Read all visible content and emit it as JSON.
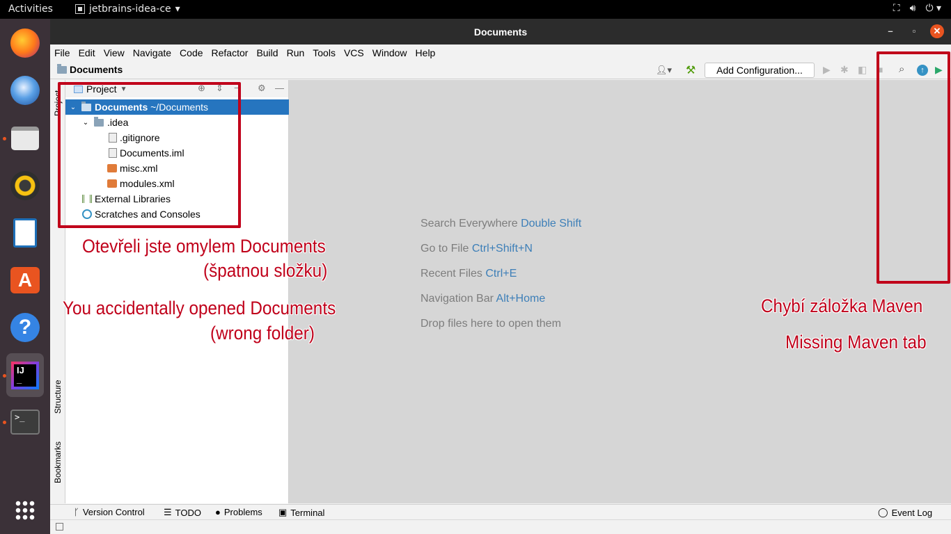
{
  "topbar": {
    "activities": "Activities",
    "app_name": "jetbrains-idea-ce"
  },
  "window": {
    "title": "Documents",
    "minimize": "–",
    "maximize": "▫",
    "close": "✕"
  },
  "menu": [
    "File",
    "Edit",
    "View",
    "Navigate",
    "Code",
    "Refactor",
    "Build",
    "Run",
    "Tools",
    "VCS",
    "Window",
    "Help"
  ],
  "navbar": {
    "breadcrumb": "Documents",
    "add_configuration": "Add Configuration..."
  },
  "stripe": {
    "project": "Project",
    "structure": "Structure",
    "bookmarks": "Bookmarks"
  },
  "project_panel": {
    "title": "Project",
    "root_name": "Documents",
    "root_path": "~/Documents",
    "tree": [
      {
        "label": ".idea",
        "type": "folder"
      },
      {
        "label": ".gitignore",
        "type": "file"
      },
      {
        "label": "Documents.iml",
        "type": "file"
      },
      {
        "label": "misc.xml",
        "type": "xml"
      },
      {
        "label": "modules.xml",
        "type": "xml"
      },
      {
        "label": "External Libraries",
        "type": "lib"
      },
      {
        "label": "Scratches and Consoles",
        "type": "scratch"
      }
    ]
  },
  "editor_hints": [
    {
      "text": "Search Everywhere ",
      "key": "Double Shift"
    },
    {
      "text": "Go to File ",
      "key": "Ctrl+Shift+N"
    },
    {
      "text": "Recent Files ",
      "key": "Ctrl+E"
    },
    {
      "text": "Navigation Bar ",
      "key": "Alt+Home"
    },
    {
      "text": "Drop files here to open them",
      "key": ""
    }
  ],
  "bottom_tabs": {
    "version_control": "Version Control",
    "todo": "TODO",
    "problems": "Problems",
    "terminal": "Terminal",
    "event_log": "Event Log"
  },
  "annotations": {
    "cz_documents_1": "Otevřeli jste omylem Documents",
    "cz_documents_2": "(špatnou složku)",
    "en_documents_1": "You accidentally opened Documents",
    "en_documents_2": "(wrong folder)",
    "cz_maven": "Chybí záložka Maven",
    "en_maven": "Missing Maven tab"
  },
  "colors": {
    "annotation_red": "#c0001a",
    "selection_blue": "#2675bf",
    "hint_key_blue": "#3d7fb8",
    "ubuntu_orange": "#e95420"
  }
}
